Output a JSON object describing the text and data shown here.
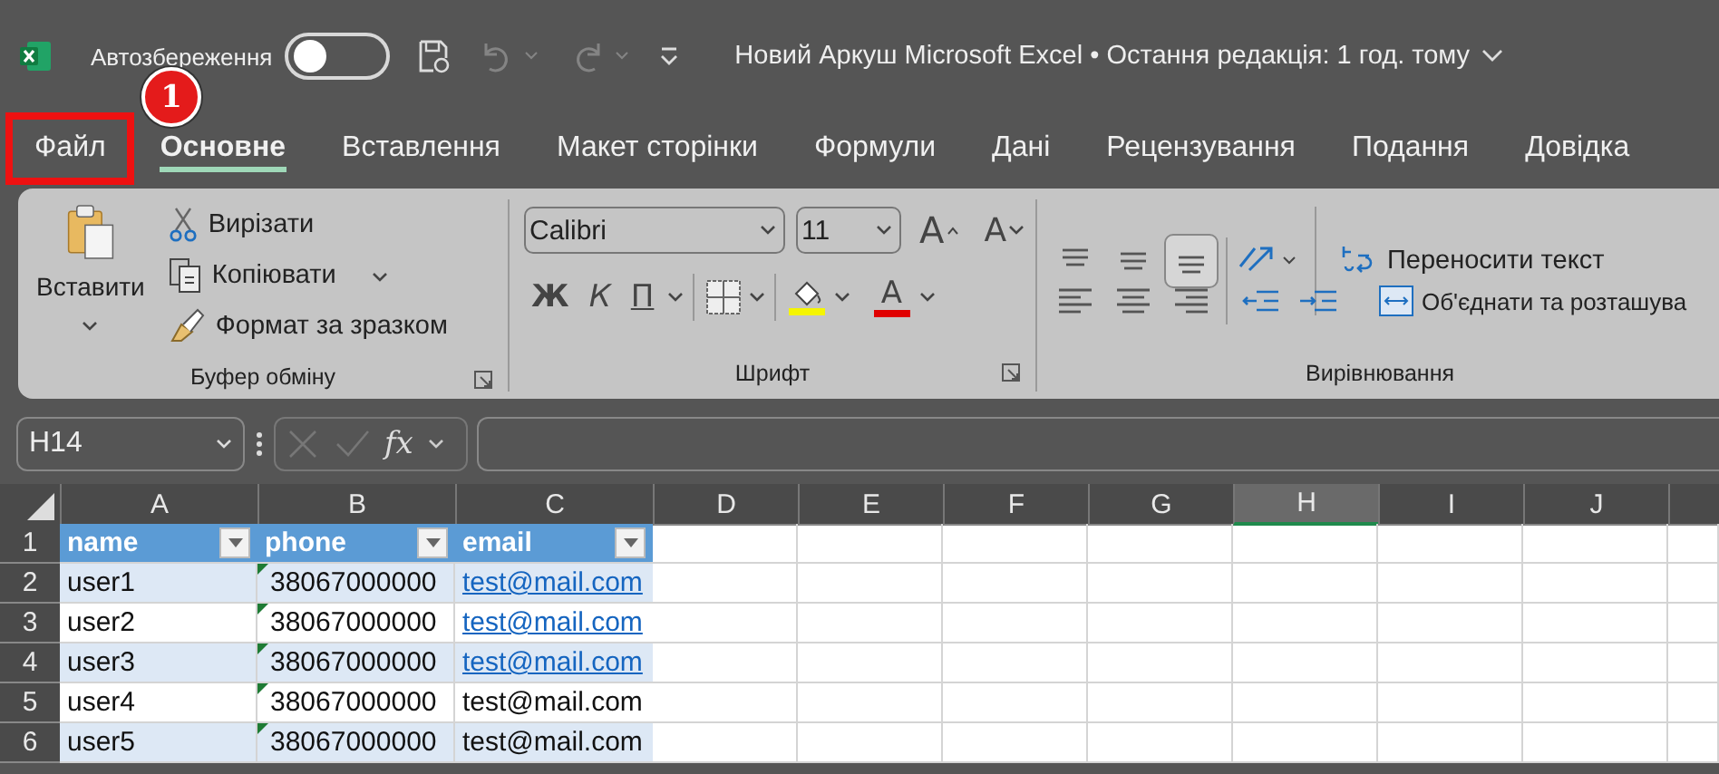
{
  "title_bar": {
    "autosave_label": "Автозбереження",
    "autosave_on": false,
    "undo_disabled": true,
    "redo_disabled": true,
    "title": "Новий Аркуш Microsoft Excel • Остання редакція: 1 год. тому"
  },
  "tabs": [
    {
      "label": "Файл",
      "selected": false,
      "highlighted": true
    },
    {
      "label": "Основне",
      "selected": true,
      "highlighted": false
    },
    {
      "label": "Вставлення",
      "selected": false,
      "highlighted": false
    },
    {
      "label": "Макет сторінки",
      "selected": false,
      "highlighted": false
    },
    {
      "label": "Формули",
      "selected": false,
      "highlighted": false
    },
    {
      "label": "Дані",
      "selected": false,
      "highlighted": false
    },
    {
      "label": "Рецензування",
      "selected": false,
      "highlighted": false
    },
    {
      "label": "Подання",
      "selected": false,
      "highlighted": false
    },
    {
      "label": "Довідка",
      "selected": false,
      "highlighted": false
    }
  ],
  "callout": {
    "number": "1"
  },
  "ribbon": {
    "clipboard": {
      "label": "Буфер обміну",
      "paste": "Вставити",
      "cut": "Вирізати",
      "copy": "Копіювати",
      "format_painter": "Формат за зразком"
    },
    "font": {
      "label": "Шрифт",
      "font_name": "Calibri",
      "font_size": "11",
      "grow": "A",
      "shrink": "A",
      "bold": "Ж",
      "italic": "К",
      "underline": "П",
      "font_color": "A"
    },
    "alignment": {
      "label": "Вирівнювання",
      "wrap_text": "Переносити текст",
      "merge": "Об'єднати та розташува",
      "vertical_align": [
        {
          "selected": false
        },
        {
          "selected": false
        },
        {
          "selected": true
        }
      ]
    }
  },
  "formula_bar": {
    "name_box": "H14",
    "function_label": "fx"
  },
  "sheet": {
    "columns": [
      {
        "label": "A",
        "selected": false
      },
      {
        "label": "B",
        "selected": false
      },
      {
        "label": "C",
        "selected": false
      },
      {
        "label": "D",
        "selected": false
      },
      {
        "label": "E",
        "selected": false
      },
      {
        "label": "F",
        "selected": false
      },
      {
        "label": "G",
        "selected": false
      },
      {
        "label": "H",
        "selected": true
      },
      {
        "label": "I",
        "selected": false
      },
      {
        "label": "J",
        "selected": false
      }
    ],
    "header": {
      "number": "1",
      "cells": [
        "name",
        "phone",
        "email"
      ]
    },
    "records": [
      {
        "number": "2",
        "name": "user1",
        "phone": "38067000000",
        "phone_warning": true,
        "email": "test@mail.com",
        "email_link": true
      },
      {
        "number": "3",
        "name": "user2",
        "phone": "38067000000",
        "phone_warning": true,
        "email": "test@mail.com",
        "email_link": true
      },
      {
        "number": "4",
        "name": "user3",
        "phone": "38067000000",
        "phone_warning": true,
        "email": "test@mail.com",
        "email_link": true
      },
      {
        "number": "5",
        "name": "user4",
        "phone": "38067000000",
        "phone_warning": true,
        "email": "test@mail.com",
        "email_link": false
      },
      {
        "number": "6",
        "name": "user5",
        "phone": "38067000000",
        "phone_warning": true,
        "email": "test@mail.com",
        "email_link": false
      }
    ]
  }
}
